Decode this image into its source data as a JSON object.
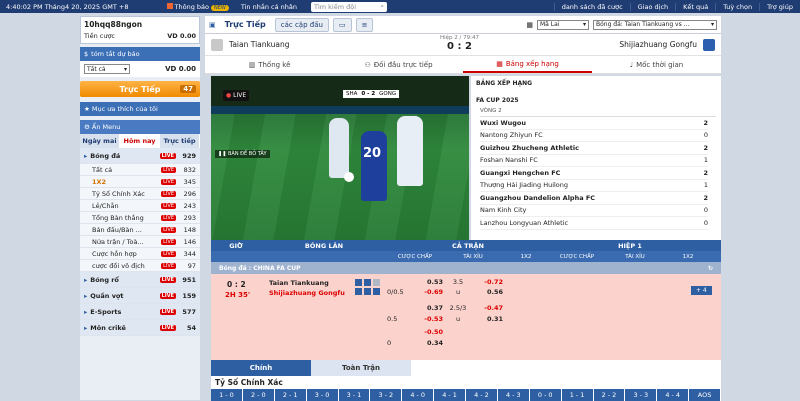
{
  "topbar": {
    "datetime": "4:40:02 PM Tháng4 20, 2025 GMT +8",
    "notice": "Thông báo",
    "notice_badge": "NEW",
    "personal": "Tin nhắn cá nhân",
    "search_placeholder": "Tìm kiếm đội",
    "links": [
      "danh sách đã cược",
      "Giao dịch",
      "Kết quả",
      "Tuỳ chọn",
      "Trợ giúp"
    ]
  },
  "sidebar": {
    "username": "10hqq88ngon",
    "bet_label": "Tiền cược",
    "bet_value": "VD 0.00",
    "summary_title": "tóm tắt dự báo",
    "filter_value": "Tất cả",
    "filter_amount": "VD 0.00",
    "live_label": "Trực Tiếp",
    "live_count": "47",
    "favorites": "Mục ưa thích của tôi",
    "hide_menu": "Ẩn Menu",
    "tabs": [
      "Ngày mai",
      "Hôm nay",
      "Trực tiếp"
    ],
    "live_tag": "LIVE",
    "sports": [
      {
        "name": "Bóng đá",
        "count": "929",
        "head": true
      },
      {
        "name": "Tất cả",
        "count": "832"
      },
      {
        "name": "1X2",
        "count": "345",
        "hl": true
      },
      {
        "name": "Tỷ Số Chính Xác",
        "count": "296"
      },
      {
        "name": "Lẻ/Chẵn",
        "count": "243"
      },
      {
        "name": "Tổng Bàn thắng",
        "count": "293"
      },
      {
        "name": "Bán đấu/Bàn ...",
        "count": "148"
      },
      {
        "name": "Nửa trận / Toà...",
        "count": "146"
      },
      {
        "name": "Cược hỗn hợp",
        "count": "344"
      },
      {
        "name": "cược đối vô địch",
        "count": "97"
      },
      {
        "name": "Bóng rổ",
        "count": "951",
        "head": true
      },
      {
        "name": "Quần vợt",
        "count": "159",
        "head": true
      },
      {
        "name": "E-Sports",
        "count": "577",
        "head": true
      },
      {
        "name": "Môn crikê",
        "count": "54",
        "head": true
      }
    ]
  },
  "main": {
    "tab_live": "Trực Tiếp",
    "tab_pairs": "các cặp đấu",
    "league_select": "Mã Lai",
    "match_select": "Bóng đá: Taian Tiankuang vs ...",
    "home_team": "Taian Tiankuang",
    "away_team": "Shijiazhuang Gongfu",
    "period": "Hiệp 2 / 79:47",
    "score": "0 : 2",
    "info_tabs": [
      "Thống kê",
      "Đối đầu trực tiếp",
      "Bảng xếp hạng",
      "Mốc thời gian"
    ],
    "video_brand": "LIVE",
    "video_caption": "BÀN ĐẾ BỎ TÂY",
    "video_score": "0 - 2",
    "video_home": "SHA",
    "video_away": "GONG",
    "player_number": "20"
  },
  "standings": {
    "title": "BẢNG XẾP HẠNG",
    "cup": "FA CUP 2025",
    "round": "VÒNG 2",
    "rows": [
      {
        "team": "Wuxi Wugou",
        "pts": "2",
        "bold": true
      },
      {
        "team": "Nantong Zhiyun FC",
        "pts": "0"
      },
      {
        "team": "Guizhou Zhucheng Athletic",
        "pts": "2",
        "bold": true
      },
      {
        "team": "Foshan Nanshi FC",
        "pts": "1"
      },
      {
        "team": "Guangxi Hengchen FC",
        "pts": "2",
        "bold": true
      },
      {
        "team": "Thượng Hải Jiading Huilong",
        "pts": "1"
      },
      {
        "team": "Guangzhou Dandelion Alpha FC",
        "pts": "2",
        "bold": true
      },
      {
        "team": "Nam Kinh City",
        "pts": "0"
      },
      {
        "team": "Lanzhou Longyuan Athletic",
        "pts": "0"
      }
    ]
  },
  "odds": {
    "col_time": "GIỜ",
    "col_match": "BÓNG LĂN",
    "full": "CẢ TRẬN",
    "half": "HIỆP 1",
    "sub": [
      "CƯỢC CHẤP",
      "TÀI XỈU",
      "1X2",
      "CƯỢC CHẤP",
      "TÀI XỈU",
      "1X2"
    ],
    "league": "Bóng đá : CHINA FA CUP",
    "score": "0 : 2",
    "time": "2H 35'",
    "home": "Taian Tiankuang",
    "away": "Shijiazhuang Gongfu",
    "more": "+ 4",
    "lines": [
      {
        "hc": "",
        "h1": "0.53",
        "ou": "3.5",
        "o1": "-0.72"
      },
      {
        "hc": "0/0.5",
        "h1": "-0.69",
        "ou": "u",
        "o1": "0.56"
      },
      {
        "hc": "",
        "h1": "0.37",
        "ou": "2.5/3",
        "o1": "-0.47"
      },
      {
        "hc": "0.5",
        "h1": "-0.53",
        "ou": "u",
        "o1": "0.31"
      },
      {
        "hc": "",
        "h1": "-0.50",
        "ou": "",
        "o1": ""
      },
      {
        "hc": "0",
        "h1": "0.34",
        "ou": "",
        "o1": ""
      }
    ]
  },
  "bottom": {
    "tab1": "Chính",
    "tab2": "Toàn Trận",
    "grid_title": "Tỷ Số Chính Xác",
    "scores": [
      "1 - 0",
      "2 - 0",
      "2 - 1",
      "3 - 0",
      "3 - 1",
      "3 - 2",
      "4 - 0",
      "4 - 1",
      "4 - 2",
      "4 - 3",
      "0 - 0",
      "1 - 1",
      "2 - 2",
      "3 - 3",
      "4 - 4",
      "AOS"
    ]
  }
}
